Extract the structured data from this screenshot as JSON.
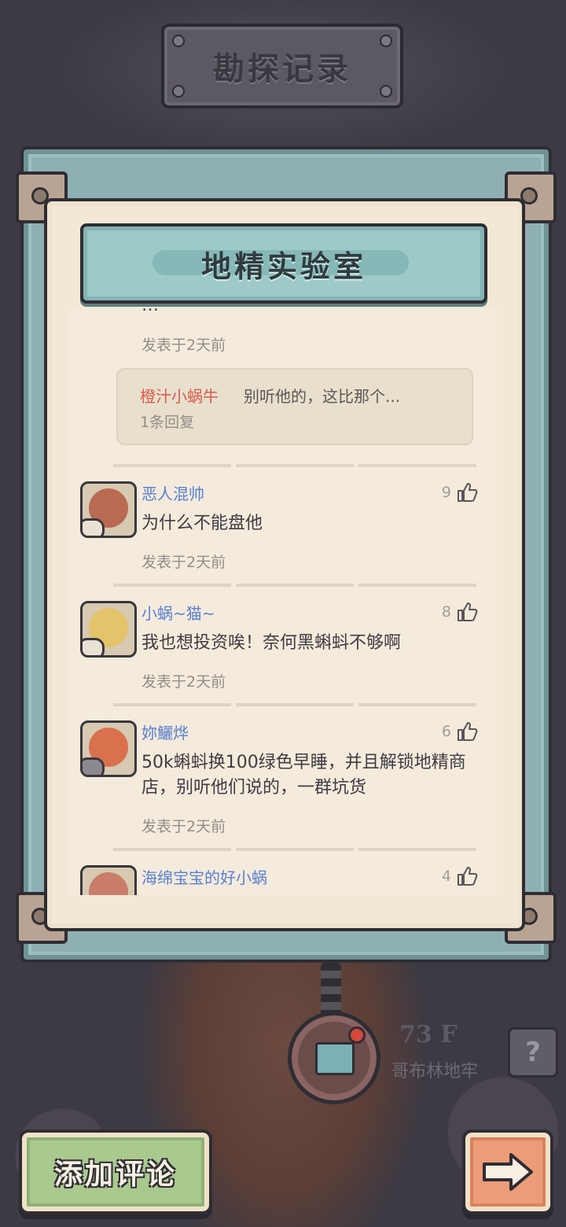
{
  "screen_title": "勘探记录",
  "panel_title": "地精实验室",
  "partial_comment": {
    "text": "…",
    "time": "发表于2天前",
    "reply": {
      "name": "橙汁小蜗牛",
      "text": "别听他的，这比那个...",
      "count": "1条回复"
    }
  },
  "comments": [
    {
      "name": "恶人混帅",
      "text": "为什么不能盘他",
      "time": "发表于2天前",
      "likes": "9"
    },
    {
      "name": "小蜗~猫~",
      "text": "我也想投资唉！奈何黑蝌蚪不够啊",
      "time": "发表于2天前",
      "likes": "8"
    },
    {
      "name": "妳鱺烨",
      "text": "50k蝌蚪换100绿色早睡，并且解锁地精商店，别听他们说的，一群坑货",
      "time": "发表于2天前",
      "likes": "6"
    },
    {
      "name": "海绵宝宝的好小蜗",
      "likes": "4"
    }
  ],
  "location": {
    "floor": "73 F",
    "name": "哥布林地牢"
  },
  "help_label": "?",
  "add_comment_label": "添加评论",
  "icons": [
    "thumbs-up-icon",
    "arrow-right-icon",
    "question-icon",
    "map-compass-icon"
  ],
  "colors": {
    "name_blue": "#5a7fd0",
    "reply_red": "#d95b4c",
    "banner_teal": "#9dcac9",
    "panel_cream": "#f4ebdd"
  }
}
